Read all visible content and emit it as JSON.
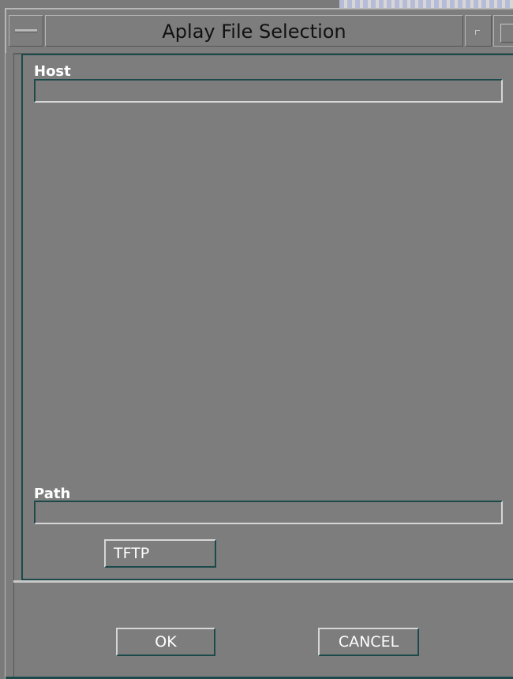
{
  "window": {
    "title": "Aplay File Selection"
  },
  "form": {
    "host_label": "Host",
    "host_value": "",
    "path_label": "Path",
    "path_value": "",
    "tftp_label": "TFTP"
  },
  "actions": {
    "ok_label": "OK",
    "cancel_label": "CANCEL"
  },
  "colors": {
    "background": "#7d7d7d",
    "border_accent": "#1c4a4a",
    "label_text": "#ffffff"
  },
  "icons": {
    "window_menu": "window-menu-icon",
    "minimize": "minimize-icon",
    "maximize": "maximize-icon"
  }
}
